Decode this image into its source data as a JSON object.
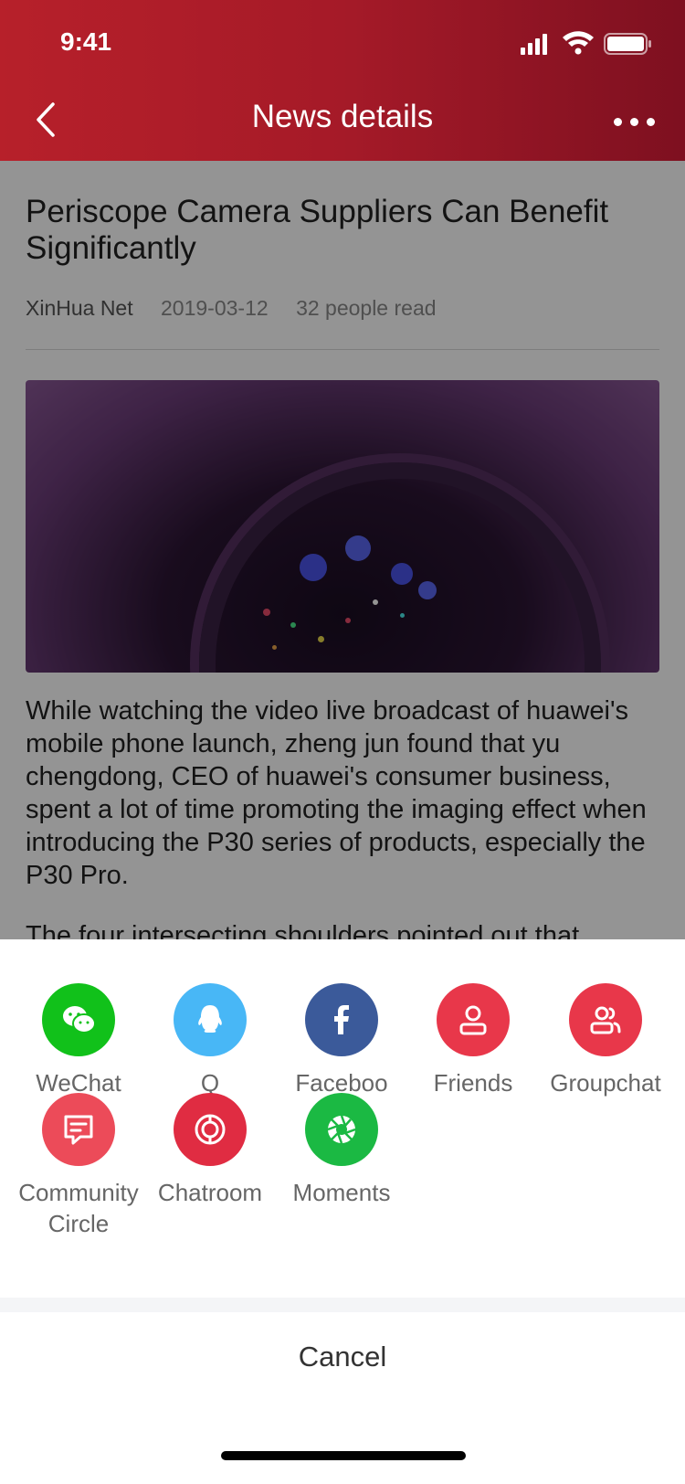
{
  "status_bar": {
    "time": "9:41"
  },
  "nav": {
    "title": "News details"
  },
  "article": {
    "title": "Periscope Camera Suppliers Can Benefit Significantly",
    "source": "XinHua Net",
    "date": "2019-03-12",
    "reads": "32 people read",
    "paragraph1": "While watching the video live broadcast of huawei's mobile phone launch, zheng jun found that yu chengdong, CEO of huawei's consumer business, spent a lot of time promoting the imaging effect when introducing the P30 series of products, especially the P30 Pro.",
    "paragraph2": "The four intersecting shoulders pointed out that"
  },
  "share": {
    "items": [
      {
        "label": "WeChat",
        "icon": "wechat-icon",
        "color": "#11c11a"
      },
      {
        "label": "QQ",
        "icon": "qq-icon",
        "color": "#48b7f6"
      },
      {
        "label": "Facebook",
        "icon": "facebook-icon",
        "color": "#3b5a9a"
      },
      {
        "label": "Friends",
        "icon": "person-icon",
        "color": "#e8374a"
      },
      {
        "label": "Groupchat",
        "icon": "group-icon",
        "color": "#e8374a"
      },
      {
        "label": "Community Circle",
        "icon": "message-icon",
        "color": "#ec4b59"
      },
      {
        "label": "Chatroom",
        "icon": "chatroom-icon",
        "color": "#e02c42"
      },
      {
        "label": "Moments",
        "icon": "aperture-icon",
        "color": "#1bb943"
      }
    ],
    "cancel_label": "Cancel"
  },
  "colors": {
    "header_start": "#b7202a",
    "header_end": "#7e1020"
  }
}
